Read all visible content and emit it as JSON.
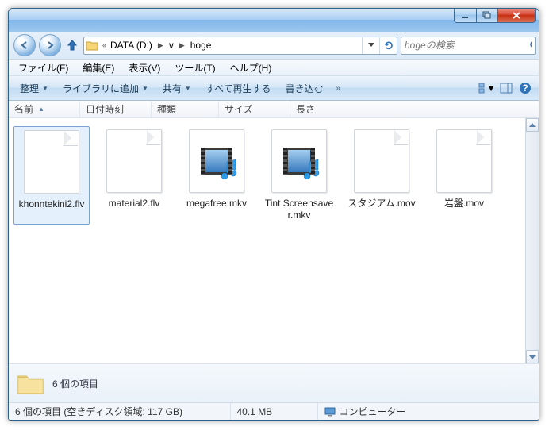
{
  "breadcrumb": {
    "drive_left": "«",
    "drive": "DATA (D:)",
    "folder1": "v",
    "folder2": "hoge"
  },
  "search": {
    "placeholder": "hogeの検索"
  },
  "menu": {
    "file": "ファイル(F)",
    "edit": "編集(E)",
    "view": "表示(V)",
    "tools": "ツール(T)",
    "help": "ヘルプ(H)"
  },
  "toolbar": {
    "organize": "整理",
    "addlib": "ライブラリに追加",
    "share": "共有",
    "playall": "すべて再生する",
    "burn": "書き込む"
  },
  "columns": {
    "name": "名前",
    "date": "日付時刻",
    "type": "種類",
    "size": "サイズ",
    "length": "長さ"
  },
  "files": [
    {
      "name": "khonntekini2.flv",
      "kind": "plain",
      "selected": true
    },
    {
      "name": "material2.flv",
      "kind": "plain"
    },
    {
      "name": "megafree.mkv",
      "kind": "media"
    },
    {
      "name": "Tint Screensaver.mkv",
      "kind": "media"
    },
    {
      "name": "スタジアム.mov",
      "kind": "plain"
    },
    {
      "name": "岩盤.mov",
      "kind": "plain"
    }
  ],
  "details": {
    "summary": "6 個の項目"
  },
  "status": {
    "items": "6 個の項目 (空きディスク領域: 117 GB)",
    "size": "40.1 MB",
    "computer": "コンピューター"
  }
}
